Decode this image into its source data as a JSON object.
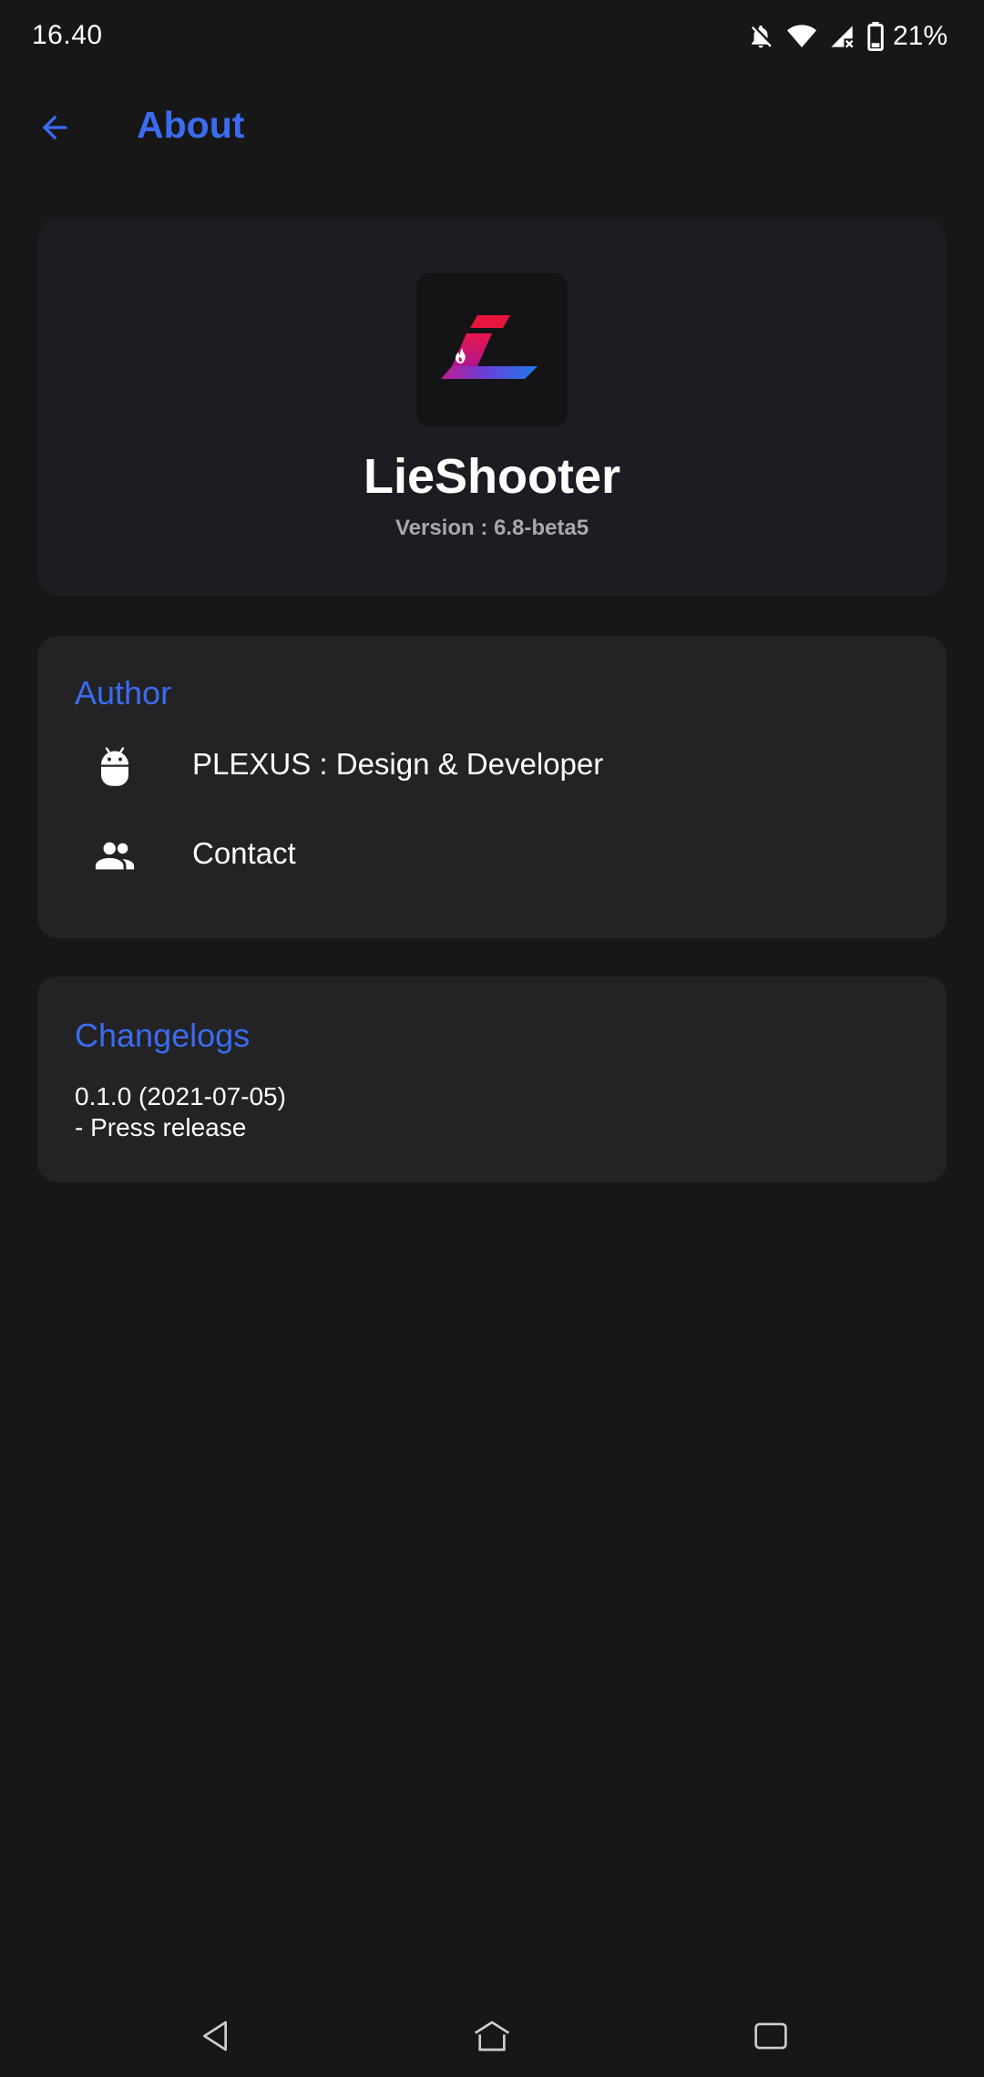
{
  "status_bar": {
    "time": "16.40",
    "battery": "21%",
    "icons": [
      "notifications-off-icon",
      "wifi-icon",
      "signal-icon",
      "battery-icon"
    ]
  },
  "app_bar": {
    "title": "About",
    "back_icon": "arrow-back-icon"
  },
  "app_info": {
    "name": "LieShooter",
    "version": "Version : 6.8-beta5",
    "logo": "lieshooter-logo"
  },
  "author": {
    "title": "Author",
    "items": [
      {
        "icon": "android-icon",
        "label": "PLEXUS : Design & Developer"
      },
      {
        "icon": "people-icon",
        "label": "Contact"
      }
    ]
  },
  "changelogs": {
    "title": "Changelogs",
    "version_line": "0.1.0 (2021-07-05)",
    "entry_line": "- Press release"
  },
  "nav_bar": {
    "icons": [
      "nav-back-icon",
      "nav-home-icon",
      "nav-recents-icon"
    ]
  },
  "colors": {
    "background": "#171718",
    "accent": "#3b6cf0",
    "card": "#232325",
    "app_card": "#1c1d22",
    "secondary_text": "#a7a8ad"
  }
}
